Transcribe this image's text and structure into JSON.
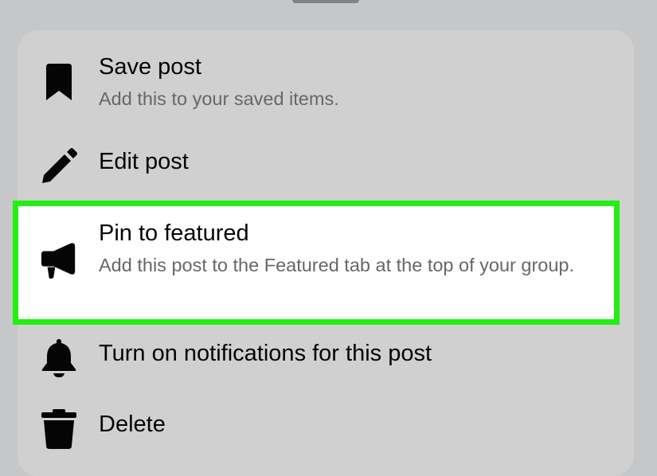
{
  "menu": {
    "items": [
      {
        "title": "Save post",
        "description": "Add this to your saved items.",
        "icon": "bookmark-icon"
      },
      {
        "title": "Edit post",
        "description": "",
        "icon": "pencil-icon"
      },
      {
        "title": "Pin to featured",
        "description": "Add this post to the Featured tab at the top of your group.",
        "icon": "megaphone-icon",
        "highlighted": true
      },
      {
        "title": "Turn on notifications for this post",
        "description": "",
        "icon": "bell-icon"
      },
      {
        "title": "Delete",
        "description": "",
        "icon": "trash-icon"
      }
    ]
  },
  "colors": {
    "background": "#c6c7c9",
    "sheet": "#d0d0d0",
    "highlight_border": "#22ef12",
    "title_text": "#050505",
    "description_text": "#65676b"
  }
}
